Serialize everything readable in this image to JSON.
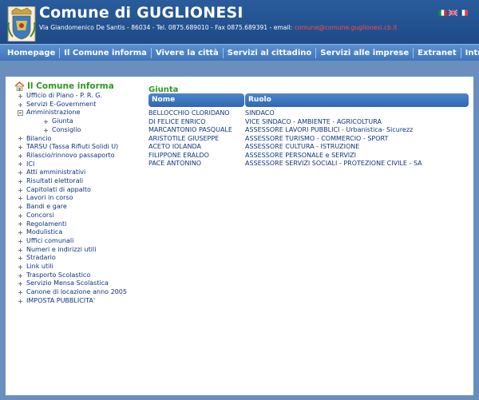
{
  "header": {
    "title": "Comune di GUGLIONESI",
    "address": "Via Giandomenico De Santis - 86034 - Tel. 0875.689010 - Fax 0875.689391 - email:",
    "email": "comune@comune.guglionesi.cb.it",
    "crest_icon": "municipal-crest-icon",
    "flags": [
      "italian-flag-icon",
      "uk-flag-icon",
      "french-flag-icon"
    ]
  },
  "nav": {
    "items": [
      "Homepage",
      "Il Comune informa",
      "Vivere la città",
      "Servizi al cittadino",
      "Servizi alle imprese",
      "Extranet",
      "Intranet"
    ]
  },
  "sidebar": {
    "title": "Il Comune informa",
    "items": [
      {
        "label": "Ufficio di Piano - P. R. G.",
        "type": "plus"
      },
      {
        "label": "Servizi E-Government",
        "type": "plus"
      },
      {
        "label": "Amministrazione",
        "type": "minus"
      },
      {
        "label": "Giunta",
        "type": "sub"
      },
      {
        "label": "Consiglio",
        "type": "sub"
      },
      {
        "label": "Bilancio",
        "type": "plus"
      },
      {
        "label": "TARSU (Tassa Rifiuti Solidi U)",
        "type": "plus"
      },
      {
        "label": "Rilascio/rinnovo passaporto",
        "type": "plus"
      },
      {
        "label": "ICI",
        "type": "plus"
      },
      {
        "label": "Atti amministrativi",
        "type": "plus"
      },
      {
        "label": "Risultati elettorali",
        "type": "plus"
      },
      {
        "label": "Capitolati di appalto",
        "type": "plus"
      },
      {
        "label": "Lavori in corso",
        "type": "plus"
      },
      {
        "label": "Bandi e gare",
        "type": "plus"
      },
      {
        "label": "Concorsi",
        "type": "plus"
      },
      {
        "label": "Regolamenti",
        "type": "plus"
      },
      {
        "label": "Modulistica",
        "type": "plus"
      },
      {
        "label": "Uffici comunali",
        "type": "plus"
      },
      {
        "label": "Numeri e indirizzi utili",
        "type": "plus"
      },
      {
        "label": "Stradario",
        "type": "plus"
      },
      {
        "label": "Link utili",
        "type": "plus"
      },
      {
        "label": "Trasporto Scolastico",
        "type": "plus"
      },
      {
        "label": "Servizio Mensa Scolastica",
        "type": "plus"
      },
      {
        "label": "Canone di locazione anno 2005",
        "type": "plus"
      },
      {
        "label": "IMPOSTA PUBBLICITA'",
        "type": "plus"
      }
    ]
  },
  "main": {
    "title": "Giunta",
    "columns": [
      "Nome",
      "Ruolo"
    ],
    "rows": [
      [
        "BELLOCCHIO CLORIDANO",
        "SINDACO"
      ],
      [
        "DI FELICE ENRICO",
        "VICE SINDACO - AMBIENTE - AGRICOLTURA"
      ],
      [
        "MARCANTONIO PASQUALE",
        "ASSESSORE LAVORI PUBBLICI - Urbanistica- Sicurezz"
      ],
      [
        "ARISTOTILE GIUSEPPE",
        "ASSESSORE TURISMO - COMMERCIO - SPORT"
      ],
      [
        "ACETO IOLANDA",
        "ASSESSORE CULTURA - ISTRUZIONE"
      ],
      [
        "FILIPPONE ERALDO",
        "ASSESSORE PERSONALE e SERVIZI"
      ],
      [
        "PACE ANTONINO",
        "ASSESSORE SERVIZI SOCIALI - PROTEZIONE CIVILE - SA"
      ]
    ]
  }
}
